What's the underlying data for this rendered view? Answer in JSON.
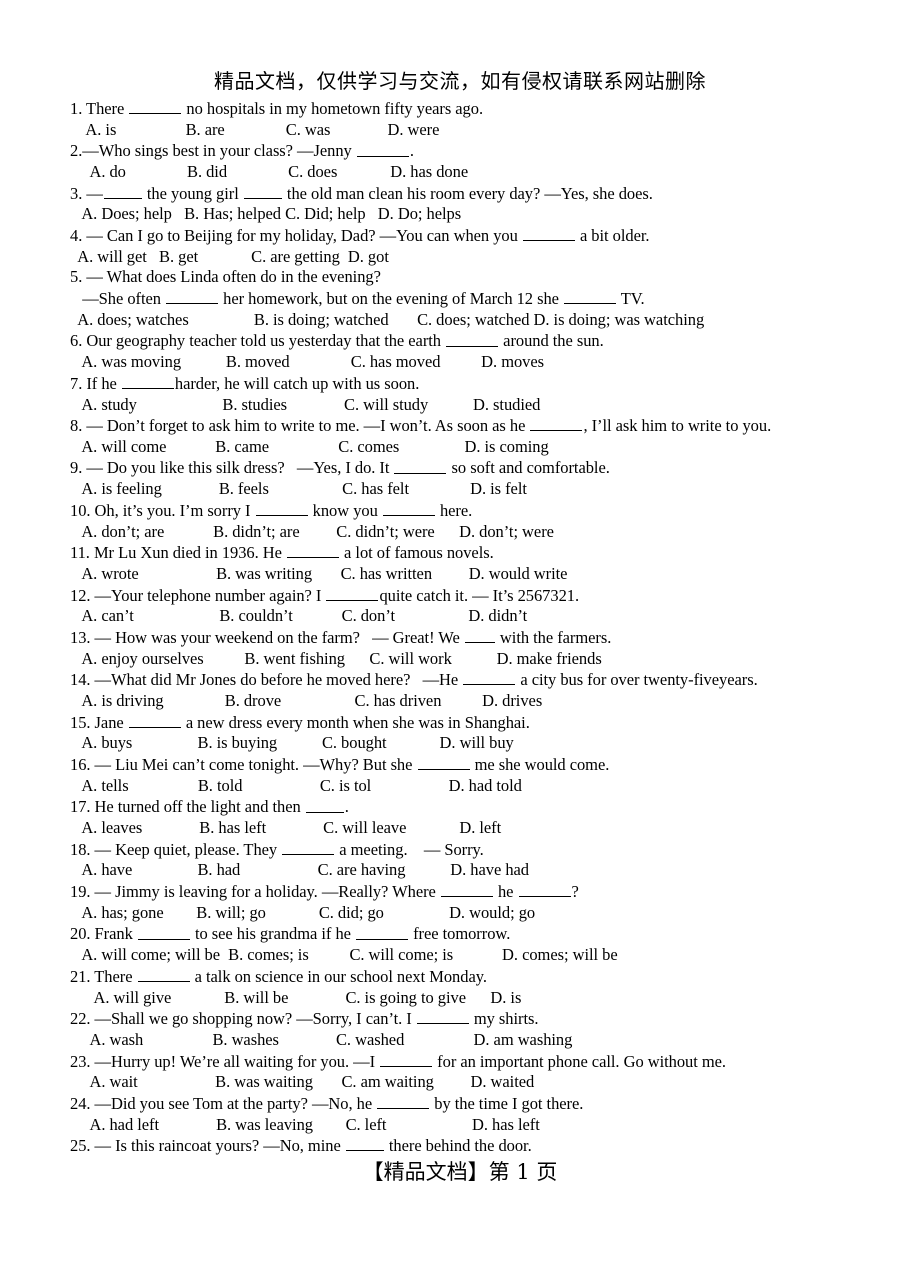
{
  "header": {
    "notice": "精品文档，仅供学习与交流，如有侵权请联系网站删除"
  },
  "footer": {
    "text": "【精品文档】第 1 页"
  },
  "questions": [
    {
      "stem_before": "1. There ",
      "stem_after": " no hospitals in my hometown fifty years ago.",
      "blank": "md",
      "options": "    A. is                 B. are               C. was              D. were"
    },
    {
      "stem_before": "2.—Who sings best in your class? —Jenny ",
      "stem_after": ".",
      "blank": "md",
      "options": "     A. do               B. did               C. does             D. has done"
    },
    {
      "stem_before": "3. —",
      "stem_mid": " the young girl ",
      "stem_after": " the old man clean his room every day? —Yes, she does.",
      "blank": "sm",
      "blank2": "sm",
      "options": "   A. Does; help   B. Has; helped C. Did; help   D. Do; helps"
    },
    {
      "stem_before": "4. — Can I go to Beijing for my holiday, Dad? —You can when you ",
      "stem_after": " a bit older.",
      "blank": "md",
      "options": "  A. will get   B. get             C. are getting  D. got"
    },
    {
      "stem_before": "5. — What does Linda often do in the evening?",
      "stem_after": "",
      "blank": "none",
      "options": ""
    },
    {
      "stem_before": "   —She often ",
      "stem_mid": " her homework, but on the evening of March 12 she ",
      "stem_after": " TV.",
      "blank": "md",
      "blank2": "md",
      "options": "  A. does; watches                B. is doing; watched       C. does; watched D. is doing; was watching"
    },
    {
      "stem_before": "6. Our geography teacher told us yesterday that the earth ",
      "stem_after": " around the sun.",
      "blank": "md",
      "options": "   A. was moving           B. moved               C. has moved          D. moves"
    },
    {
      "stem_before": "7. If he ",
      "stem_after": "harder, he will catch up with us soon.",
      "blank": "md",
      "options": "   A. study                     B. studies              C. will study           D. studied"
    },
    {
      "stem_before": "8. — Don’t forget to ask him to write to me. —I won’t. As soon as he ",
      "stem_after": ", I’ll ask him to write to you.",
      "blank": "md",
      "options": "   A. will come            B. came                 C. comes                D. is coming"
    },
    {
      "stem_before": "9. — Do you like this silk dress?   —Yes, I do. It ",
      "stem_after": " so soft and comfortable.",
      "blank": "md",
      "options": "   A. is feeling              B. feels                  C. has felt               D. is felt"
    },
    {
      "stem_before": "10. Oh, it’s you. I’m sorry I ",
      "stem_mid": " know you ",
      "stem_after": " here.",
      "blank": "md",
      "blank2": "md",
      "options": "   A. don’t; are            B. didn’t; are         C. didn’t; were      D. don’t; were"
    },
    {
      "stem_before": "11. Mr Lu Xun died in 1936. He ",
      "stem_after": " a lot of famous novels.",
      "blank": "md",
      "options": "   A. wrote                   B. was writing       C. has written         D. would write"
    },
    {
      "stem_before": "12. —Your telephone number again? I ",
      "stem_after": "quite catch it. — It’s 2567321.",
      "blank": "md",
      "options": "   A. can’t                     B. couldn’t            C. don’t                  D. didn’t"
    },
    {
      "stem_before": "13. — How was your weekend on the farm?   — Great! We ",
      "stem_after": " with the farmers.",
      "blank": "xs",
      "options": "   A. enjoy ourselves          B. went fishing      C. will work           D. make friends"
    },
    {
      "stem_before": "14. —What did Mr Jones do before he moved here?   —He ",
      "stem_after": " a city bus for over twenty-fiveyears.",
      "blank": "md",
      "options": "   A. is driving               B. drove                  C. has driven          D. drives"
    },
    {
      "stem_before": "15. Jane ",
      "stem_after": " a new dress every month when she was in Shanghai.",
      "blank": "md",
      "options": "   A. buys                B. is buying           C. bought             D. will buy"
    },
    {
      "stem_before": "16. — Liu Mei can’t come tonight. —Why? But she ",
      "stem_after": " me she would come.",
      "blank": "md",
      "options": "   A. tells                 B. told                   C. is tol                   D. had told"
    },
    {
      "stem_before": "17. He turned off the light and then ",
      "stem_after": ".",
      "blank": "sm",
      "options": "   A. leaves              B. has left              C. will leave             D. left"
    },
    {
      "stem_before": "18. — Keep quiet, please. They ",
      "stem_after": " a meeting.    — Sorry.",
      "blank": "md",
      "options": "   A. have                B. had                   C. are having           D. have had"
    },
    {
      "stem_before": "19. — Jimmy is leaving for a holiday. —Really? Where ",
      "stem_mid": " he ",
      "stem_after": "?",
      "blank": "md",
      "blank2": "md",
      "options": "   A. has; gone        B. will; go             C. did; go                D. would; go"
    },
    {
      "stem_before": "20. Frank ",
      "stem_mid": " to see his grandma if he ",
      "stem_after": " free tomorrow.",
      "blank": "md",
      "blank2": "md",
      "options": "   A. will come; will be  B. comes; is          C. will come; is            D. comes; will be"
    },
    {
      "stem_before": "21. There ",
      "stem_after": " a talk on science in our school next Monday.",
      "blank": "md",
      "options": "      A. will give             B. will be              C. is going to give      D. is"
    },
    {
      "stem_before": "22. —Shall we go shopping now? —Sorry, I can’t. I ",
      "stem_after": " my shirts.",
      "blank": "md",
      "options": "     A. wash                 B. washes              C. washed                 D. am washing"
    },
    {
      "stem_before": "23. —Hurry up! We’re all waiting for you. —I ",
      "stem_after": " for an important phone call. Go without me.",
      "blank": "md",
      "options": "     A. wait                   B. was waiting       C. am waiting         D. waited"
    },
    {
      "stem_before": "24. —Did you see Tom at the party? —No, he ",
      "stem_after": " by the time I got there.",
      "blank": "md",
      "options": "     A. had left              B. was leaving        C. left                     D. has left"
    },
    {
      "stem_before": "25. — Is this raincoat yours? —No, mine ",
      "stem_after": " there behind the door.",
      "blank": "sm",
      "options": ""
    }
  ]
}
